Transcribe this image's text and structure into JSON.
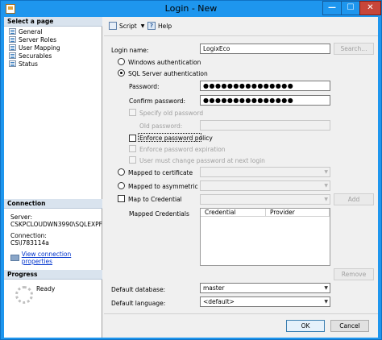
{
  "window": {
    "title": "Login - New",
    "minimize_glyph": "—",
    "maximize_glyph": "☐",
    "close_glyph": "✕"
  },
  "left": {
    "select_page_header": "Select a page",
    "pages": [
      "General",
      "Server Roles",
      "User Mapping",
      "Securables",
      "Status"
    ],
    "connection_header": "Connection",
    "server_label": "Server:",
    "server_value": "CSKPCLOUDWN3990\\SQLEXPF",
    "connection_label": "Connection:",
    "connection_value": "CS\\l783114a",
    "view_connection_link": "View connection properties",
    "progress_header": "Progress",
    "progress_status": "Ready"
  },
  "toolbar": {
    "script_label": "Script",
    "help_label": "Help"
  },
  "form": {
    "login_name_label": "Login name:",
    "login_name_value": "LogixEco",
    "search_button": "Search...",
    "windows_auth": "Windows authentication",
    "sql_auth": "SQL Server authentication",
    "password_label": "Password:",
    "password_value": "●●●●●●●●●●●●●●●",
    "confirm_password_label": "Confirm password:",
    "confirm_password_value": "●●●●●●●●●●●●●●●",
    "specify_old_password": "Specify old password",
    "old_password_label": "Old password:",
    "enforce_policy": "Enforce password policy",
    "enforce_expiration": "Enforce password expiration",
    "must_change": "User must change password at next login",
    "mapped_certificate": "Mapped to certificate",
    "mapped_asym_key": "Mapped to asymmetric key",
    "map_credential": "Map to Credential",
    "add_button": "Add",
    "mapped_credentials_label": "Mapped Credentials",
    "grid_columns": [
      "Credential",
      "Provider"
    ],
    "remove_button": "Remove",
    "default_database_label": "Default database:",
    "default_database_value": "master",
    "default_language_label": "Default language:",
    "default_language_value": "<default>"
  },
  "footer": {
    "ok": "OK",
    "cancel": "Cancel"
  }
}
